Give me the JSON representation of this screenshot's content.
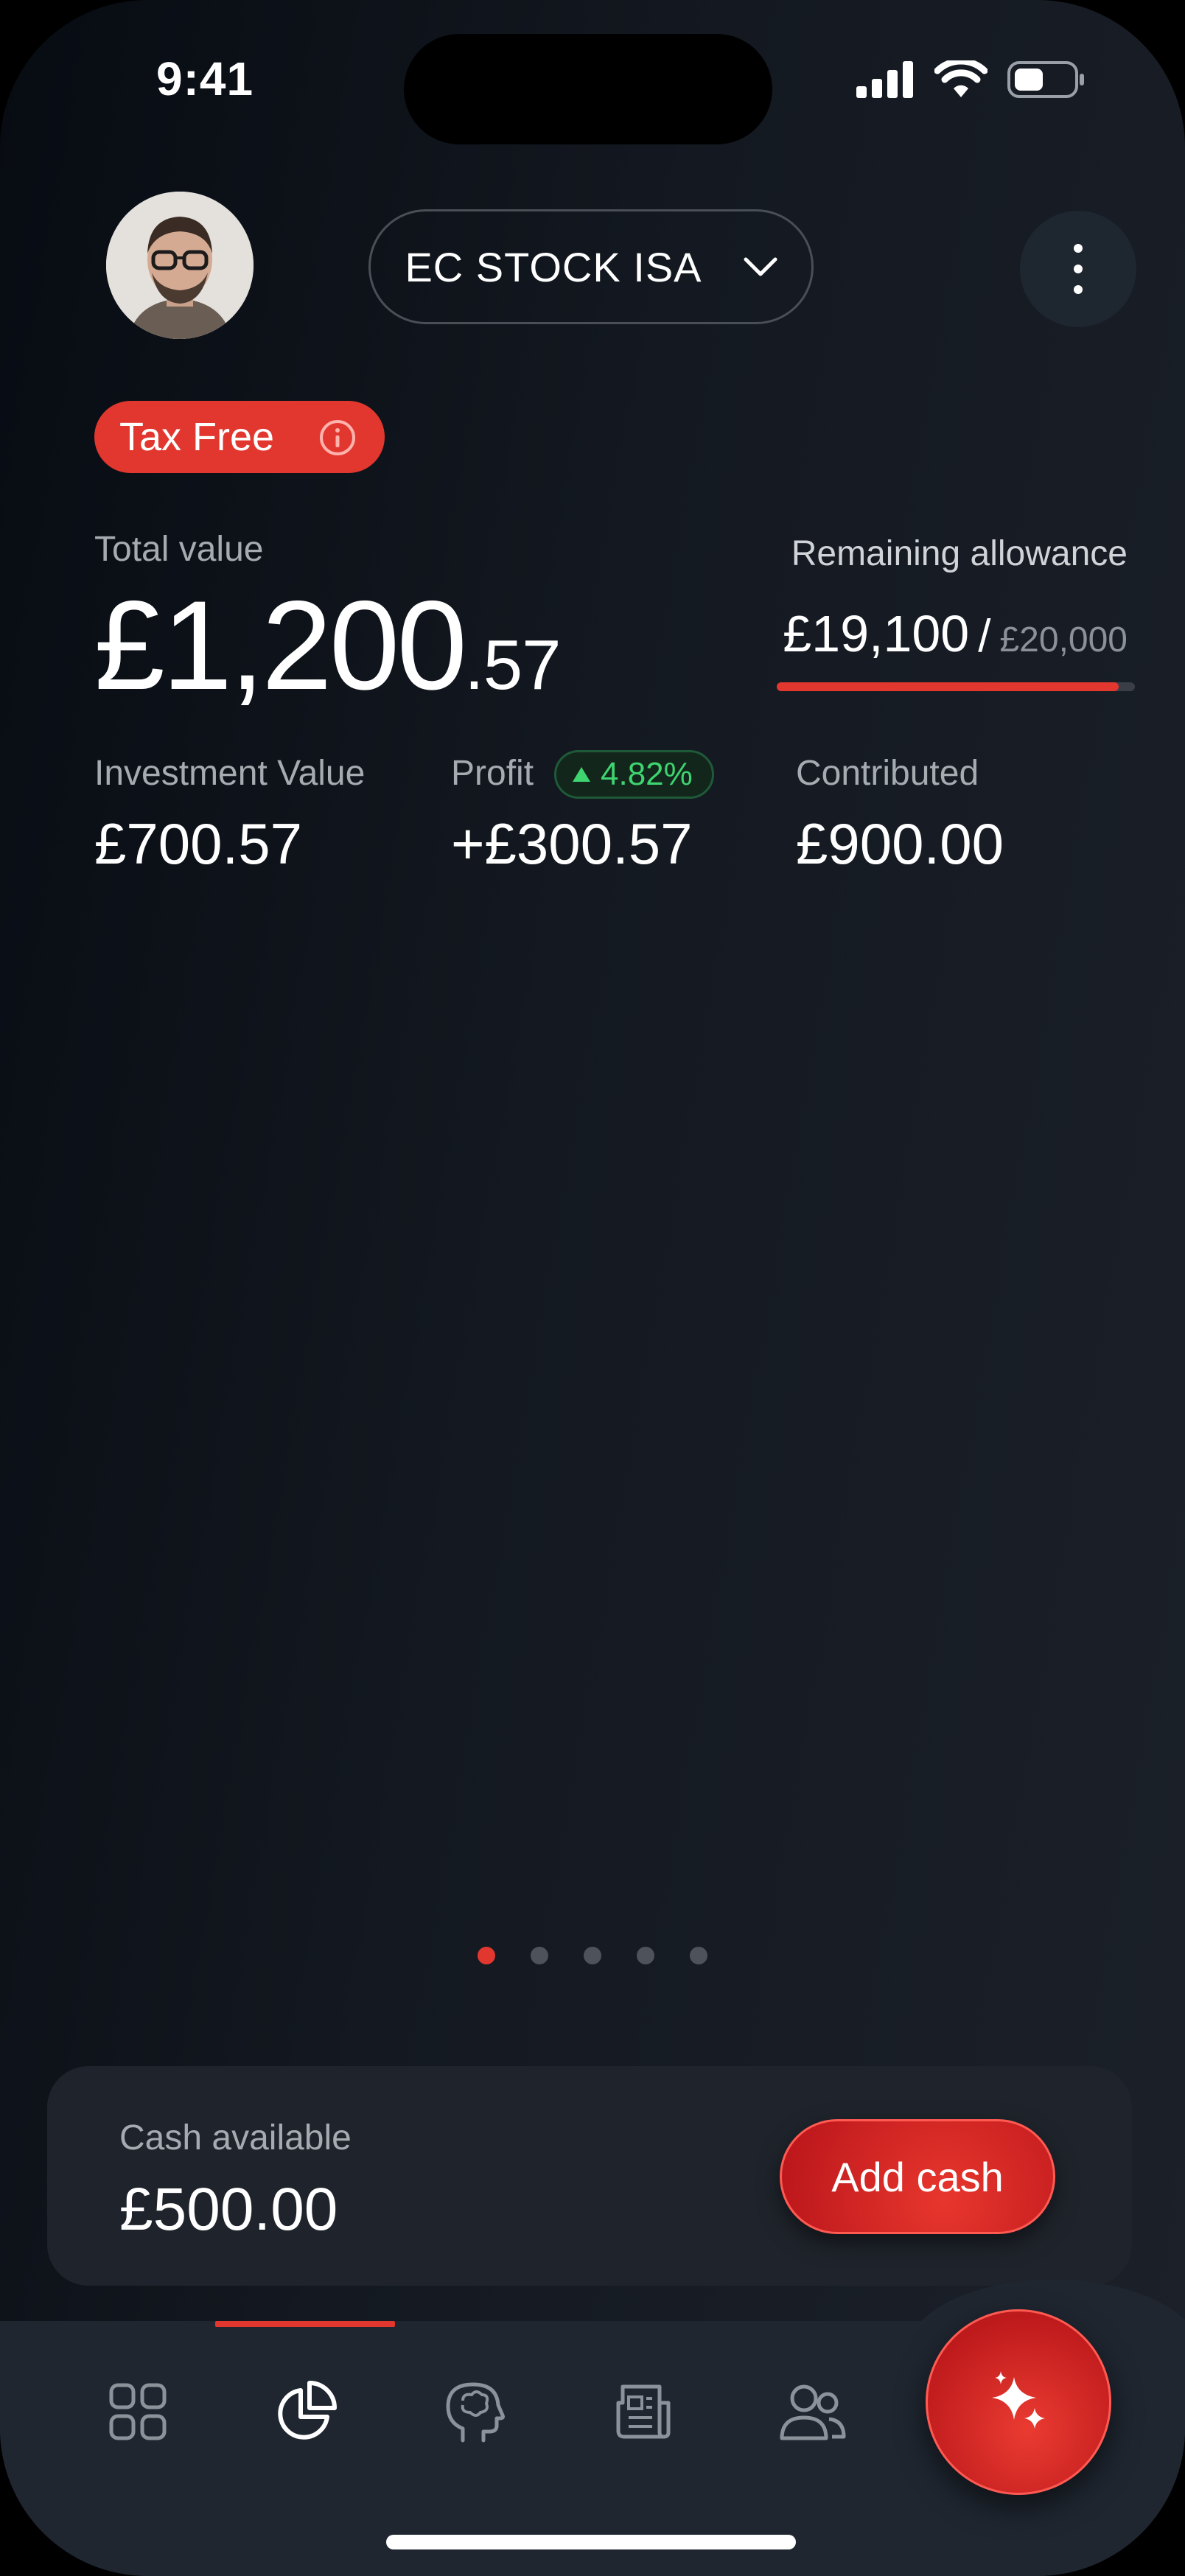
{
  "status_bar": {
    "time": "9:41"
  },
  "header": {
    "account_name": "EC STOCK ISA",
    "tax_badge": "Tax Free"
  },
  "summary": {
    "total_label": "Total value",
    "total_whole": "£1,200",
    "total_decimal": ".57",
    "allowance_label": "Remaining allowance",
    "allowance_remaining": "£19,100",
    "allowance_separator": "/",
    "allowance_total": "£20,000",
    "allowance_used_fraction": 0.955
  },
  "stats": {
    "investment_label": "Investment Value",
    "investment_value": "£700.57",
    "profit_label": "Profit",
    "profit_change": "4.82%",
    "profit_value": "+£300.57",
    "contributed_label": "Contributed",
    "contributed_value": "£900.00"
  },
  "pagination": {
    "total_pages": 5,
    "active_page": 1
  },
  "cash": {
    "label": "Cash available",
    "value": "£500.00",
    "button_label": "Add cash"
  },
  "bottom_nav": {
    "items": [
      "dashboard-icon",
      "portfolio-pie-icon",
      "ai-brain-icon",
      "news-icon",
      "community-icon"
    ],
    "active_index": 1,
    "fab_icon": "sparkles-icon"
  },
  "colors": {
    "accent": "#e2372f",
    "positive": "#3ed46f",
    "background": "#141921",
    "card": "#1f242c"
  }
}
